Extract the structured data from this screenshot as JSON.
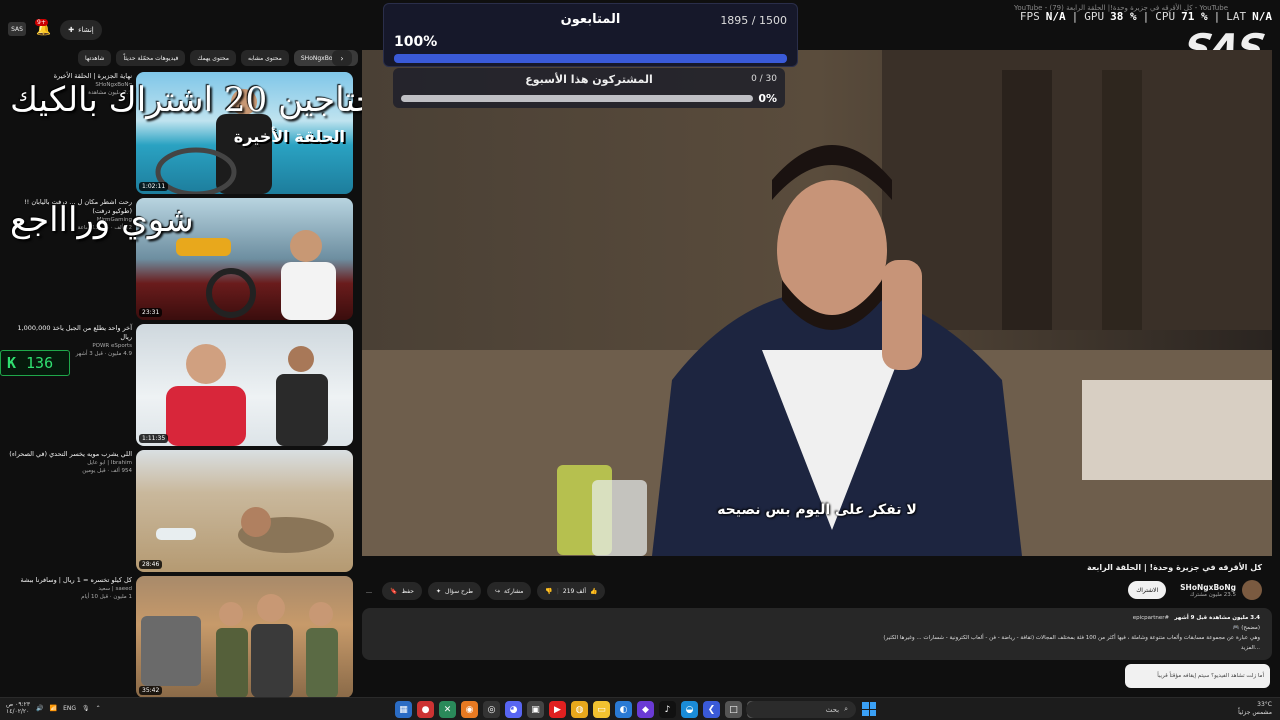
{
  "window": {
    "title": "YouTube - كل الأقرقه في جزيرة وحدة!| الحلقة الرابعة (79) - YouTube"
  },
  "stats": {
    "fps_label": "FPS",
    "fps": "N/A",
    "gpu_label": "GPU",
    "gpu": "38 %",
    "cpu_label": "CPU",
    "cpu": "71 %",
    "lat_label": "LAT",
    "lat": "N/A"
  },
  "logo": "SAS",
  "header": {
    "create_label": "إنشاء",
    "create_icon": "plus-icon",
    "notif_count": "9+",
    "avatar_text": "SAS"
  },
  "chips": [
    "من SHoNgxBoNg",
    "محتوى مشابه",
    "محتوى يهمك",
    "فيديوهات محمّلة حديثاً",
    "شاهدتها"
  ],
  "overlay": {
    "line1": "محتاجين 20 اشتراك بالكيك",
    "line2": "شوي وراااجع"
  },
  "counter": {
    "icon": "kick-icon",
    "value": "136"
  },
  "followers": {
    "title": "المتابعون",
    "count": "1895 / 1500",
    "percent_text": "100%",
    "percent": 1.0
  },
  "weekly": {
    "title": "المشتركون هذا الأسبوع",
    "count": "0 / 30",
    "percent_text": "0%",
    "percent": 0
  },
  "related": [
    {
      "title": "نهاية الجزيرة | الحلقة الأخيرة",
      "channel": "SHoNgxBoNg",
      "meta": "2.9 مليون مشاهدة",
      "duration": "1:02:11",
      "thumb_text": "الحلقة الأخيرة"
    },
    {
      "title": "رحت اشطر مكان ل ... درفت باليابان !! (طوكيو درفت)",
      "channel": "MjrmGaming",
      "meta": "12 ألف · قبل 13 ساعة",
      "duration": "23:31",
      "thumb_text": ""
    },
    {
      "title": "آخر واحد يطلع من الجبل ياخذ 1,000,000 ريال",
      "channel": "POWR eSports",
      "meta": "4.9 مليون · قبل 3 أشهر",
      "duration": "1:11:35",
      "thumb_text": ""
    },
    {
      "title": "اللي يشرب مويه يخسر التحدي (في الصحراء)",
      "channel": "Ibrahim | ابو عايل",
      "meta": "954 ألف · قبل يومين",
      "duration": "28:46",
      "thumb_text": ""
    },
    {
      "title": "كل كيلو تخسره = 1 ريال | وسافرنا ببشة",
      "channel": "saeed | سعيد",
      "meta": "1 مليون · قبل 10 أيام",
      "duration": "35:42",
      "thumb_text": ""
    }
  ],
  "video": {
    "subtitle": "لا تفكر على اليوم بس نصيحه",
    "title": "كل الأقرقه في جزيرة وحدة! | الحلقة الرابعة"
  },
  "channel": {
    "name": "SHoNgxBoNg",
    "subs": "23.5 مليون مشترك",
    "subscribe": "الاشتراك"
  },
  "actions": {
    "likes": "219 ألف",
    "share": "مشاركة",
    "ask": "طرح سؤال",
    "save": "حفظ",
    "more": "…"
  },
  "description": {
    "stats": "3.4 مليون مشاهدة قبل 9 أشهر",
    "tag": "#epicpartner",
    "line1": "(مضمح) 🎮",
    "line2": "وهي عبارة عن مجموعة مسابقات وألعاب متنوعة وشاملة ، فيها أكثر من 100 فئة بمختلف المجالات (ثقافة - رياضة - فن - ألعاب الكترونية - شسارات ... وغيرها الكثير)",
    "more": "...المزيد"
  },
  "chat_prompt": "أما زلت تشاهد الفيديو؟ سيتم إيقافه مؤقتاً قريباً",
  "taskbar": {
    "search": "بحث",
    "lang": "ENG",
    "time": "٠٩:٢٣ ص",
    "date": "١٤/٠٢/٢٠",
    "temp": "33°C",
    "weather": "مشمس جزئياً"
  }
}
